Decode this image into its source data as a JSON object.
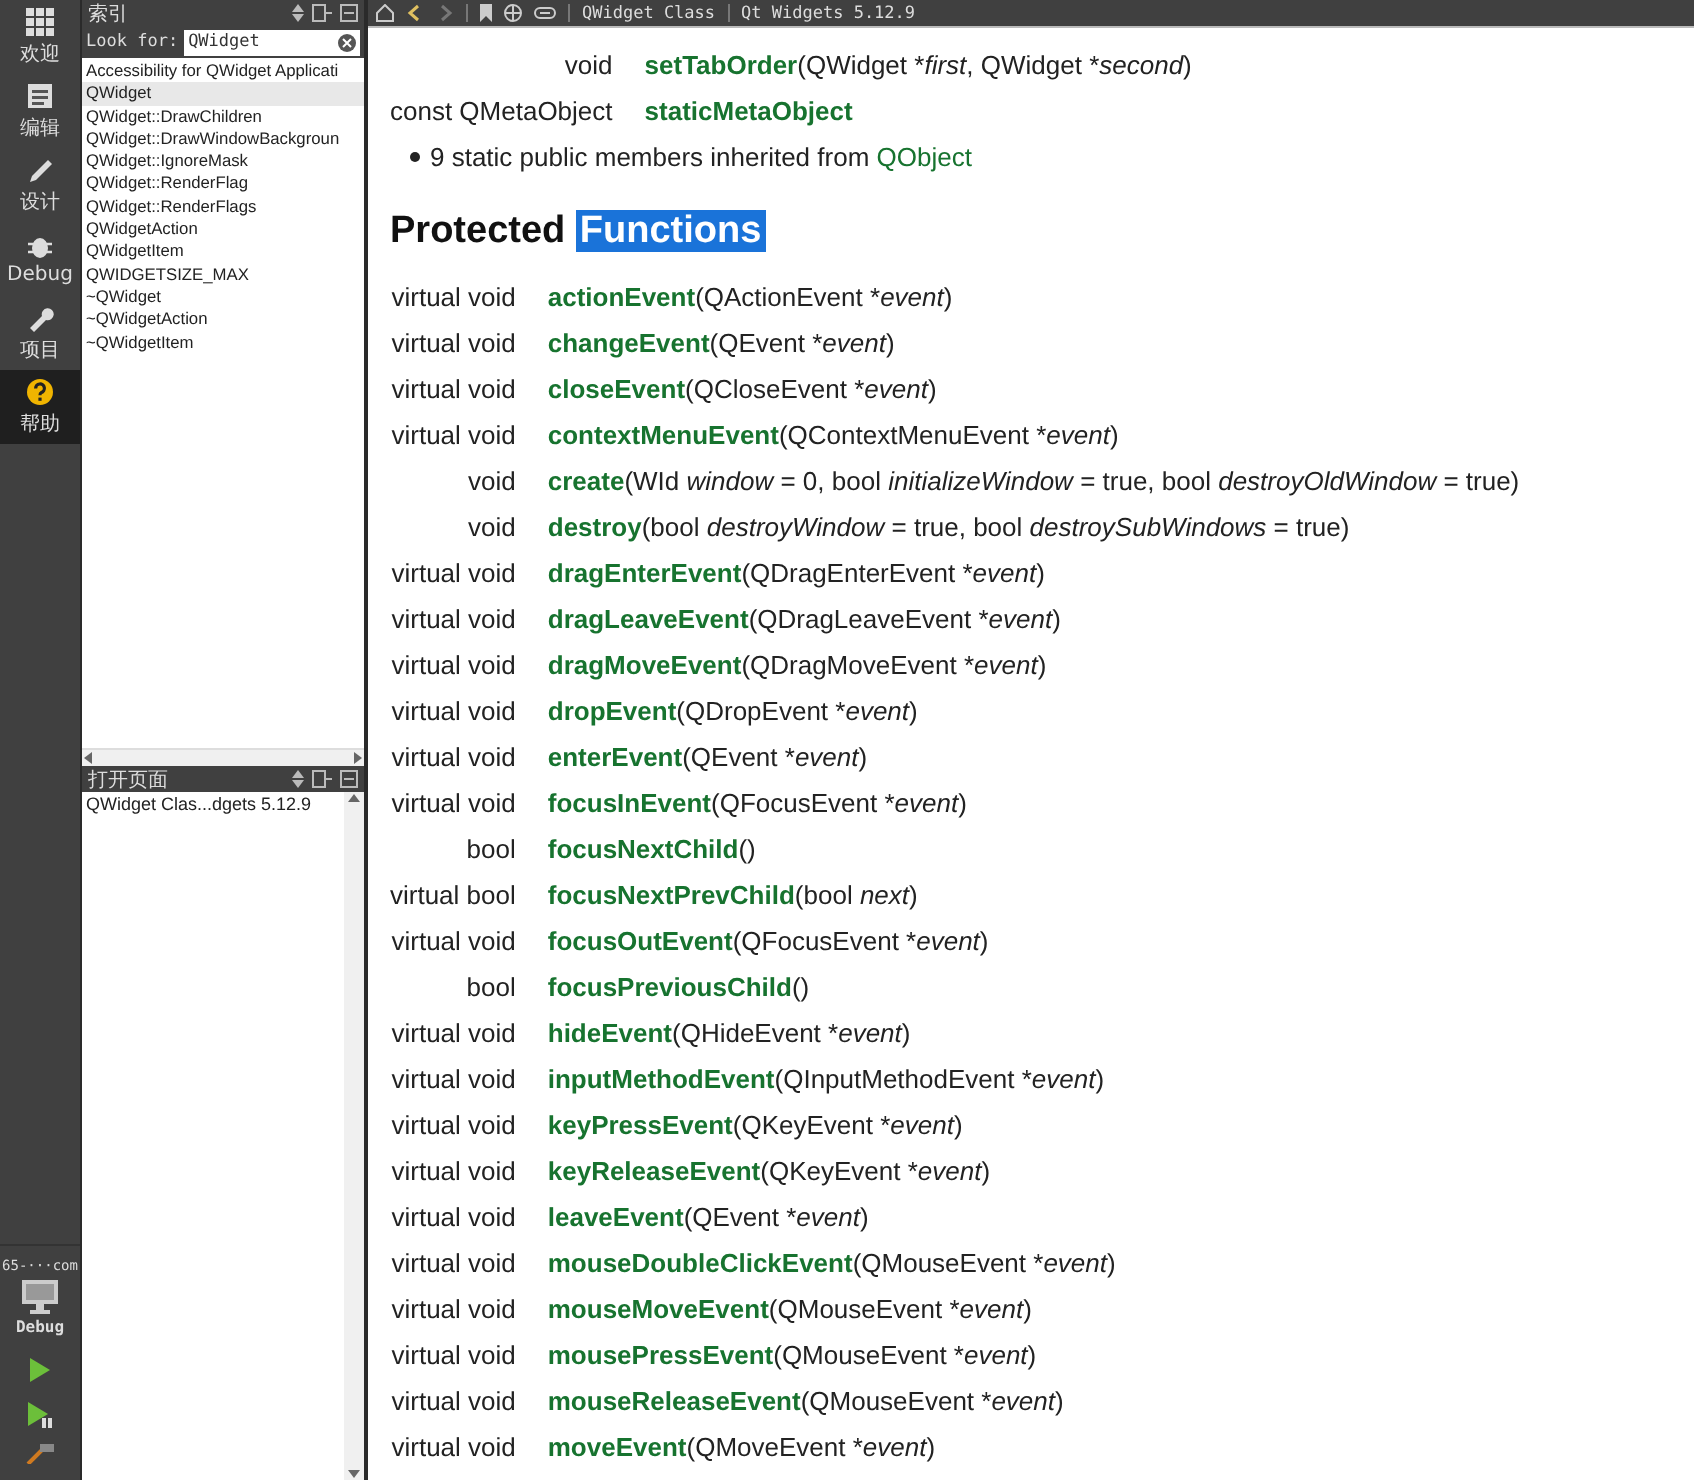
{
  "mode_bar": {
    "modes": [
      {
        "label": "欢迎",
        "selected": false
      },
      {
        "label": "编辑",
        "selected": false
      },
      {
        "label": "设计",
        "selected": false
      },
      {
        "label": "Debug",
        "selected": false
      },
      {
        "label": "项目",
        "selected": false
      },
      {
        "label": "帮助",
        "selected": true
      }
    ],
    "kit": {
      "name": "65-···com",
      "build": "Debug"
    }
  },
  "index_panel": {
    "title": "索引",
    "search": {
      "label": "Look for:",
      "value": "QWidget"
    },
    "results": [
      {
        "label": "Accessibility for QWidget Applicati",
        "selected": false
      },
      {
        "label": "QWidget",
        "selected": true
      },
      {
        "label": "QWidget::DrawChildren",
        "selected": false
      },
      {
        "label": "QWidget::DrawWindowBackgroun",
        "selected": false
      },
      {
        "label": "QWidget::IgnoreMask",
        "selected": false
      },
      {
        "label": "QWidget::RenderFlag",
        "selected": false
      },
      {
        "label": "QWidget::RenderFlags",
        "selected": false
      },
      {
        "label": "QWidgetAction",
        "selected": false
      },
      {
        "label": "QWidgetItem",
        "selected": false
      },
      {
        "label": "QWIDGETSIZE_MAX",
        "selected": false
      },
      {
        "label": "~QWidget",
        "selected": false
      },
      {
        "label": "~QWidgetAction",
        "selected": false
      },
      {
        "label": "~QWidgetItem",
        "selected": false
      }
    ]
  },
  "open_pages": {
    "title": "打开页面",
    "pages": [
      {
        "label": "QWidget Clas...dgets 5.12.9",
        "selected": false
      }
    ]
  },
  "doc": {
    "breadcrumb": [
      "QWidget Class",
      "Qt Widgets 5.12.9"
    ],
    "static_members": [
      {
        "type": "void",
        "name": "setTabOrder",
        "params": [
          {
            "text": "(QWidget *",
            "italic": false
          },
          {
            "text": "first",
            "italic": true
          },
          {
            "text": ", QWidget *",
            "italic": false
          },
          {
            "text": "second",
            "italic": true
          },
          {
            "text": ")",
            "italic": false
          }
        ]
      },
      {
        "type": "const QMetaObject",
        "name": "staticMetaObject"
      }
    ],
    "inherited_note": {
      "text": "9 static public members inherited from ",
      "link": "QObject"
    },
    "section_title": {
      "text": "Protected ",
      "highlighted": "Functions"
    },
    "functions": [
      {
        "type": "virtual void",
        "name": "actionEvent",
        "params": [
          {
            "text": "(QActionEvent *",
            "italic": false
          },
          {
            "text": "event",
            "italic": true
          },
          {
            "text": ")",
            "italic": false
          }
        ]
      },
      {
        "type": "virtual void",
        "name": "changeEvent",
        "params": [
          {
            "text": "(QEvent *",
            "italic": false
          },
          {
            "text": "event",
            "italic": true
          },
          {
            "text": ")",
            "italic": false
          }
        ]
      },
      {
        "type": "virtual void",
        "name": "closeEvent",
        "params": [
          {
            "text": "(QCloseEvent *",
            "italic": false
          },
          {
            "text": "event",
            "italic": true
          },
          {
            "text": ")",
            "italic": false
          }
        ]
      },
      {
        "type": "virtual void",
        "name": "contextMenuEvent",
        "params": [
          {
            "text": "(QContextMenuEvent *",
            "italic": false
          },
          {
            "text": "event",
            "italic": true
          },
          {
            "text": ")",
            "italic": false
          }
        ]
      },
      {
        "type": "void",
        "name": "create",
        "params": [
          {
            "text": "(WId ",
            "italic": false
          },
          {
            "text": "window",
            "italic": true
          },
          {
            "text": " = 0, bool ",
            "italic": false
          },
          {
            "text": "initializeWindow",
            "italic": true
          },
          {
            "text": " = true, bool ",
            "italic": false
          },
          {
            "text": "destroyOldWindow",
            "italic": true
          },
          {
            "text": " = true)",
            "italic": false
          }
        ]
      },
      {
        "type": "void",
        "name": "destroy",
        "params": [
          {
            "text": "(bool ",
            "italic": false
          },
          {
            "text": "destroyWindow",
            "italic": true
          },
          {
            "text": " = true, bool ",
            "italic": false
          },
          {
            "text": "destroySubWindows",
            "italic": true
          },
          {
            "text": " = true)",
            "italic": false
          }
        ]
      },
      {
        "type": "virtual void",
        "name": "dragEnterEvent",
        "params": [
          {
            "text": "(QDragEnterEvent *",
            "italic": false
          },
          {
            "text": "event",
            "italic": true
          },
          {
            "text": ")",
            "italic": false
          }
        ]
      },
      {
        "type": "virtual void",
        "name": "dragLeaveEvent",
        "params": [
          {
            "text": "(QDragLeaveEvent *",
            "italic": false
          },
          {
            "text": "event",
            "italic": true
          },
          {
            "text": ")",
            "italic": false
          }
        ]
      },
      {
        "type": "virtual void",
        "name": "dragMoveEvent",
        "params": [
          {
            "text": "(QDragMoveEvent *",
            "italic": false
          },
          {
            "text": "event",
            "italic": true
          },
          {
            "text": ")",
            "italic": false
          }
        ]
      },
      {
        "type": "virtual void",
        "name": "dropEvent",
        "params": [
          {
            "text": "(QDropEvent *",
            "italic": false
          },
          {
            "text": "event",
            "italic": true
          },
          {
            "text": ")",
            "italic": false
          }
        ]
      },
      {
        "type": "virtual void",
        "name": "enterEvent",
        "params": [
          {
            "text": "(QEvent *",
            "italic": false
          },
          {
            "text": "event",
            "italic": true
          },
          {
            "text": ")",
            "italic": false
          }
        ]
      },
      {
        "type": "virtual void",
        "name": "focusInEvent",
        "params": [
          {
            "text": "(QFocusEvent *",
            "italic": false
          },
          {
            "text": "event",
            "italic": true
          },
          {
            "text": ")",
            "italic": false
          }
        ]
      },
      {
        "type": "bool",
        "name": "focusNextChild",
        "params": [
          {
            "text": "()",
            "italic": false
          }
        ]
      },
      {
        "type": "virtual bool",
        "name": "focusNextPrevChild",
        "params": [
          {
            "text": "(bool ",
            "italic": false
          },
          {
            "text": "next",
            "italic": true
          },
          {
            "text": ")",
            "italic": false
          }
        ]
      },
      {
        "type": "virtual void",
        "name": "focusOutEvent",
        "params": [
          {
            "text": "(QFocusEvent *",
            "italic": false
          },
          {
            "text": "event",
            "italic": true
          },
          {
            "text": ")",
            "italic": false
          }
        ]
      },
      {
        "type": "bool",
        "name": "focusPreviousChild",
        "params": [
          {
            "text": "()",
            "italic": false
          }
        ]
      },
      {
        "type": "virtual void",
        "name": "hideEvent",
        "params": [
          {
            "text": "(QHideEvent *",
            "italic": false
          },
          {
            "text": "event",
            "italic": true
          },
          {
            "text": ")",
            "italic": false
          }
        ]
      },
      {
        "type": "virtual void",
        "name": "inputMethodEvent",
        "params": [
          {
            "text": "(QInputMethodEvent *",
            "italic": false
          },
          {
            "text": "event",
            "italic": true
          },
          {
            "text": ")",
            "italic": false
          }
        ]
      },
      {
        "type": "virtual void",
        "name": "keyPressEvent",
        "params": [
          {
            "text": "(QKeyEvent *",
            "italic": false
          },
          {
            "text": "event",
            "italic": true
          },
          {
            "text": ")",
            "italic": false
          }
        ]
      },
      {
        "type": "virtual void",
        "name": "keyReleaseEvent",
        "params": [
          {
            "text": "(QKeyEvent *",
            "italic": false
          },
          {
            "text": "event",
            "italic": true
          },
          {
            "text": ")",
            "italic": false
          }
        ]
      },
      {
        "type": "virtual void",
        "name": "leaveEvent",
        "params": [
          {
            "text": "(QEvent *",
            "italic": false
          },
          {
            "text": "event",
            "italic": true
          },
          {
            "text": ")",
            "italic": false
          }
        ]
      },
      {
        "type": "virtual void",
        "name": "mouseDoubleClickEvent",
        "params": [
          {
            "text": "(QMouseEvent *",
            "italic": false
          },
          {
            "text": "event",
            "italic": true
          },
          {
            "text": ")",
            "italic": false
          }
        ]
      },
      {
        "type": "virtual void",
        "name": "mouseMoveEvent",
        "params": [
          {
            "text": "(QMouseEvent *",
            "italic": false
          },
          {
            "text": "event",
            "italic": true
          },
          {
            "text": ")",
            "italic": false
          }
        ]
      },
      {
        "type": "virtual void",
        "name": "mousePressEvent",
        "params": [
          {
            "text": "(QMouseEvent *",
            "italic": false
          },
          {
            "text": "event",
            "italic": true
          },
          {
            "text": ")",
            "italic": false
          }
        ]
      },
      {
        "type": "virtual void",
        "name": "mouseReleaseEvent",
        "params": [
          {
            "text": "(QMouseEvent *",
            "italic": false
          },
          {
            "text": "event",
            "italic": true
          },
          {
            "text": ")",
            "italic": false
          }
        ]
      },
      {
        "type": "virtual void",
        "name": "moveEvent",
        "params": [
          {
            "text": "(QMoveEvent *",
            "italic": false
          },
          {
            "text": "event",
            "italic": true
          },
          {
            "text": ")",
            "italic": false
          }
        ]
      }
    ]
  }
}
